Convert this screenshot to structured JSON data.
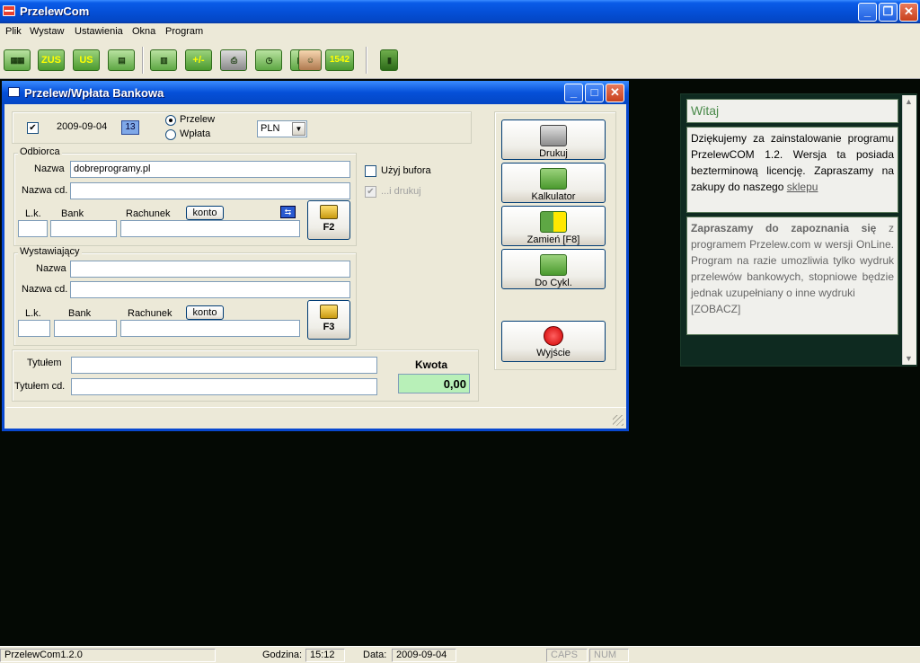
{
  "app": {
    "title": "PrzelewCom"
  },
  "menu": [
    "Plik",
    "Wystaw",
    "Ustawienia",
    "Okna",
    "Program"
  ],
  "toolbar": {
    "zus": "ZUS",
    "us": "US",
    "calc": "+/-",
    "num": "1542"
  },
  "child": {
    "title": "Przelew/Wpłata Bankowa",
    "date": "2009-09-04",
    "cal_btn": "13",
    "radio_przelew": "Przelew",
    "radio_wplata": "Wpłata",
    "currency": "PLN",
    "odbiorca": {
      "group": "Odbiorca",
      "nazwa_label": "Nazwa",
      "nazwa_value": "dobreprogramy.pl",
      "nazwacd_label": "Nazwa cd.",
      "lk_label": "L.k.",
      "bank_label": "Bank",
      "rachunek_label": "Rachunek",
      "konto_btn": "konto",
      "book_btn": "F2"
    },
    "bufor": "Użyj bufora",
    "drukuj_chk": "...i drukuj",
    "wystawiajacy": {
      "group": "Wystawiający",
      "nazwa_label": "Nazwa",
      "nazwacd_label": "Nazwa cd.",
      "lk_label": "L.k.",
      "bank_label": "Bank",
      "rachunek_label": "Rachunek",
      "konto_btn": "konto",
      "book_btn": "F3"
    },
    "tytulem_label": "Tytułem",
    "tytulemcd_label": "Tytułem cd.",
    "kwota_label": "Kwota",
    "kwota_value": "0,00",
    "buttons": {
      "drukuj": "Drukuj",
      "kalkulator": "Kalkulator",
      "zamien": "Zamień [F8]",
      "docykl": "Do Cykl.",
      "wyjscie": "Wyjście"
    }
  },
  "welcome": {
    "title": "Witaj",
    "text1": "Dziękujemy za zainstalowanie programu PrzelewCOM 1.2. Wersja ta posiada bezterminową licencję. Zapraszamy na zakupy do naszego",
    "link1": "sklepu",
    "text2_bold": "Zapraszamy do zapoznania się",
    "text2": "z programem Przelew.com w wersji OnLine. Program na razie umozliwia tylko wydruk przelewów bankowych, stopniowe będzie jednak uzupełniany o inne wydruki",
    "link2": "[ZOBACZ]"
  },
  "status": {
    "version": "PrzelewCom1.2.0",
    "godzina_label": "Godzina:",
    "godzina": "15:12",
    "data_label": "Data:",
    "data": "2009-09-04",
    "caps": "CAPS",
    "num": "NUM"
  }
}
